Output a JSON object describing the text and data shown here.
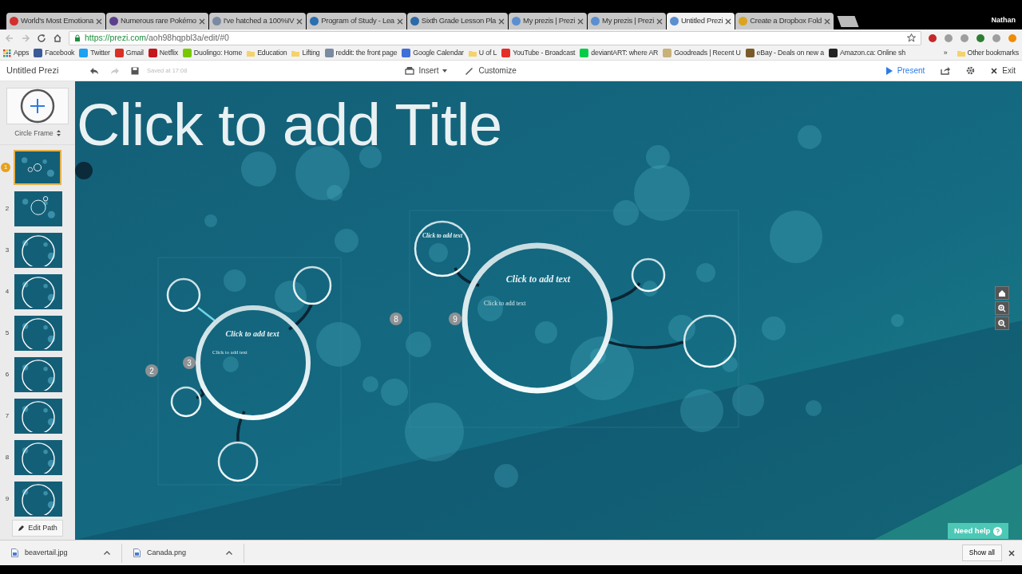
{
  "browser": {
    "tabs": [
      {
        "title": "World's Most Emotiona",
        "color": "#d32f2f",
        "selected": false
      },
      {
        "title": "Numerous rare Pokémo",
        "color": "#5b3f8c",
        "selected": false
      },
      {
        "title": "I've hatched a 100%IV",
        "color": "#7a8aa0",
        "selected": false
      },
      {
        "title": "Program of Study - Lea",
        "color": "#2a6fb0",
        "selected": false
      },
      {
        "title": "Sixth Grade Lesson Pla",
        "color": "#2c6aa6",
        "selected": false
      },
      {
        "title": "My prezis | Prezi",
        "color": "#5b8fd0",
        "selected": false
      },
      {
        "title": "My prezis | Prezi",
        "color": "#5b8fd0",
        "selected": false
      },
      {
        "title": "Untitled Prezi",
        "color": "#5b8fd0",
        "selected": true
      },
      {
        "title": "Create a Dropbox Fold",
        "color": "#d9a520",
        "selected": false
      }
    ],
    "profile_name": "Nathan",
    "address": {
      "scheme_host": "https://prezi.com",
      "path": "/aoh98hqpbl3a/edit/#0"
    },
    "bookmarks": [
      {
        "label": "Apps",
        "kind": "apps"
      },
      {
        "label": "Facebook",
        "kind": "site",
        "color": "#3b5998"
      },
      {
        "label": "Twitter",
        "kind": "site",
        "color": "#1da1f2"
      },
      {
        "label": "Gmail",
        "kind": "site",
        "color": "#d93025"
      },
      {
        "label": "Netflix",
        "kind": "site",
        "color": "#c4161c"
      },
      {
        "label": "Duolingo: Home",
        "kind": "site",
        "color": "#78c800"
      },
      {
        "label": "Education",
        "kind": "folder",
        "color": "#f4d36b"
      },
      {
        "label": "Lifting",
        "kind": "folder",
        "color": "#f4d36b"
      },
      {
        "label": "reddit: the front page",
        "kind": "site",
        "color": "#7a8aa0"
      },
      {
        "label": "Google Calendar",
        "kind": "site",
        "color": "#3f6fd8"
      },
      {
        "label": "U of L",
        "kind": "folder",
        "color": "#f4d36b"
      },
      {
        "label": "YouTube - Broadcast",
        "kind": "site",
        "color": "#e52d27"
      },
      {
        "label": "deviantART: where AR",
        "kind": "site",
        "color": "#05cc47"
      },
      {
        "label": "Goodreads | Recent U",
        "kind": "site",
        "color": "#c8b27a"
      },
      {
        "label": "eBay - Deals on new a",
        "kind": "site",
        "color": "#7b5a2a"
      },
      {
        "label": "Amazon.ca: Online sh",
        "kind": "site",
        "color": "#222222"
      }
    ],
    "overflow": "»",
    "other_bookmarks": "Other bookmarks"
  },
  "editor": {
    "title": "Untitled Prezi",
    "saved_status": "Saved at 17:08",
    "insert": "Insert",
    "customize": "Customize",
    "present": "Present",
    "exit": "Exit"
  },
  "sidebar": {
    "frame_tool": "Circle Frame",
    "slides": [
      {
        "number": "1",
        "selected": true
      },
      {
        "number": "2",
        "selected": false
      },
      {
        "number": "3",
        "selected": false
      },
      {
        "number": "4",
        "selected": false
      },
      {
        "number": "5",
        "selected": false
      },
      {
        "number": "6",
        "selected": false
      },
      {
        "number": "7",
        "selected": false
      },
      {
        "number": "8",
        "selected": false
      },
      {
        "number": "9",
        "selected": false
      }
    ],
    "edit_path": "Edit Path"
  },
  "canvas": {
    "title": "Click to add Title",
    "frames": [
      {
        "kind": "large",
        "title": "Click to add text",
        "body": "Click to add text"
      },
      {
        "kind": "large",
        "title": "Click to add text",
        "body": "Click to add text"
      },
      {
        "kind": "small",
        "title": "Click to add text"
      }
    ],
    "path_numbers": [
      "2",
      "3",
      "8",
      "9"
    ],
    "help_button": "Need help"
  },
  "downloads": {
    "files": [
      {
        "name": "beavertail.jpg"
      },
      {
        "name": "Canada.png"
      }
    ],
    "show_all": "Show all"
  }
}
